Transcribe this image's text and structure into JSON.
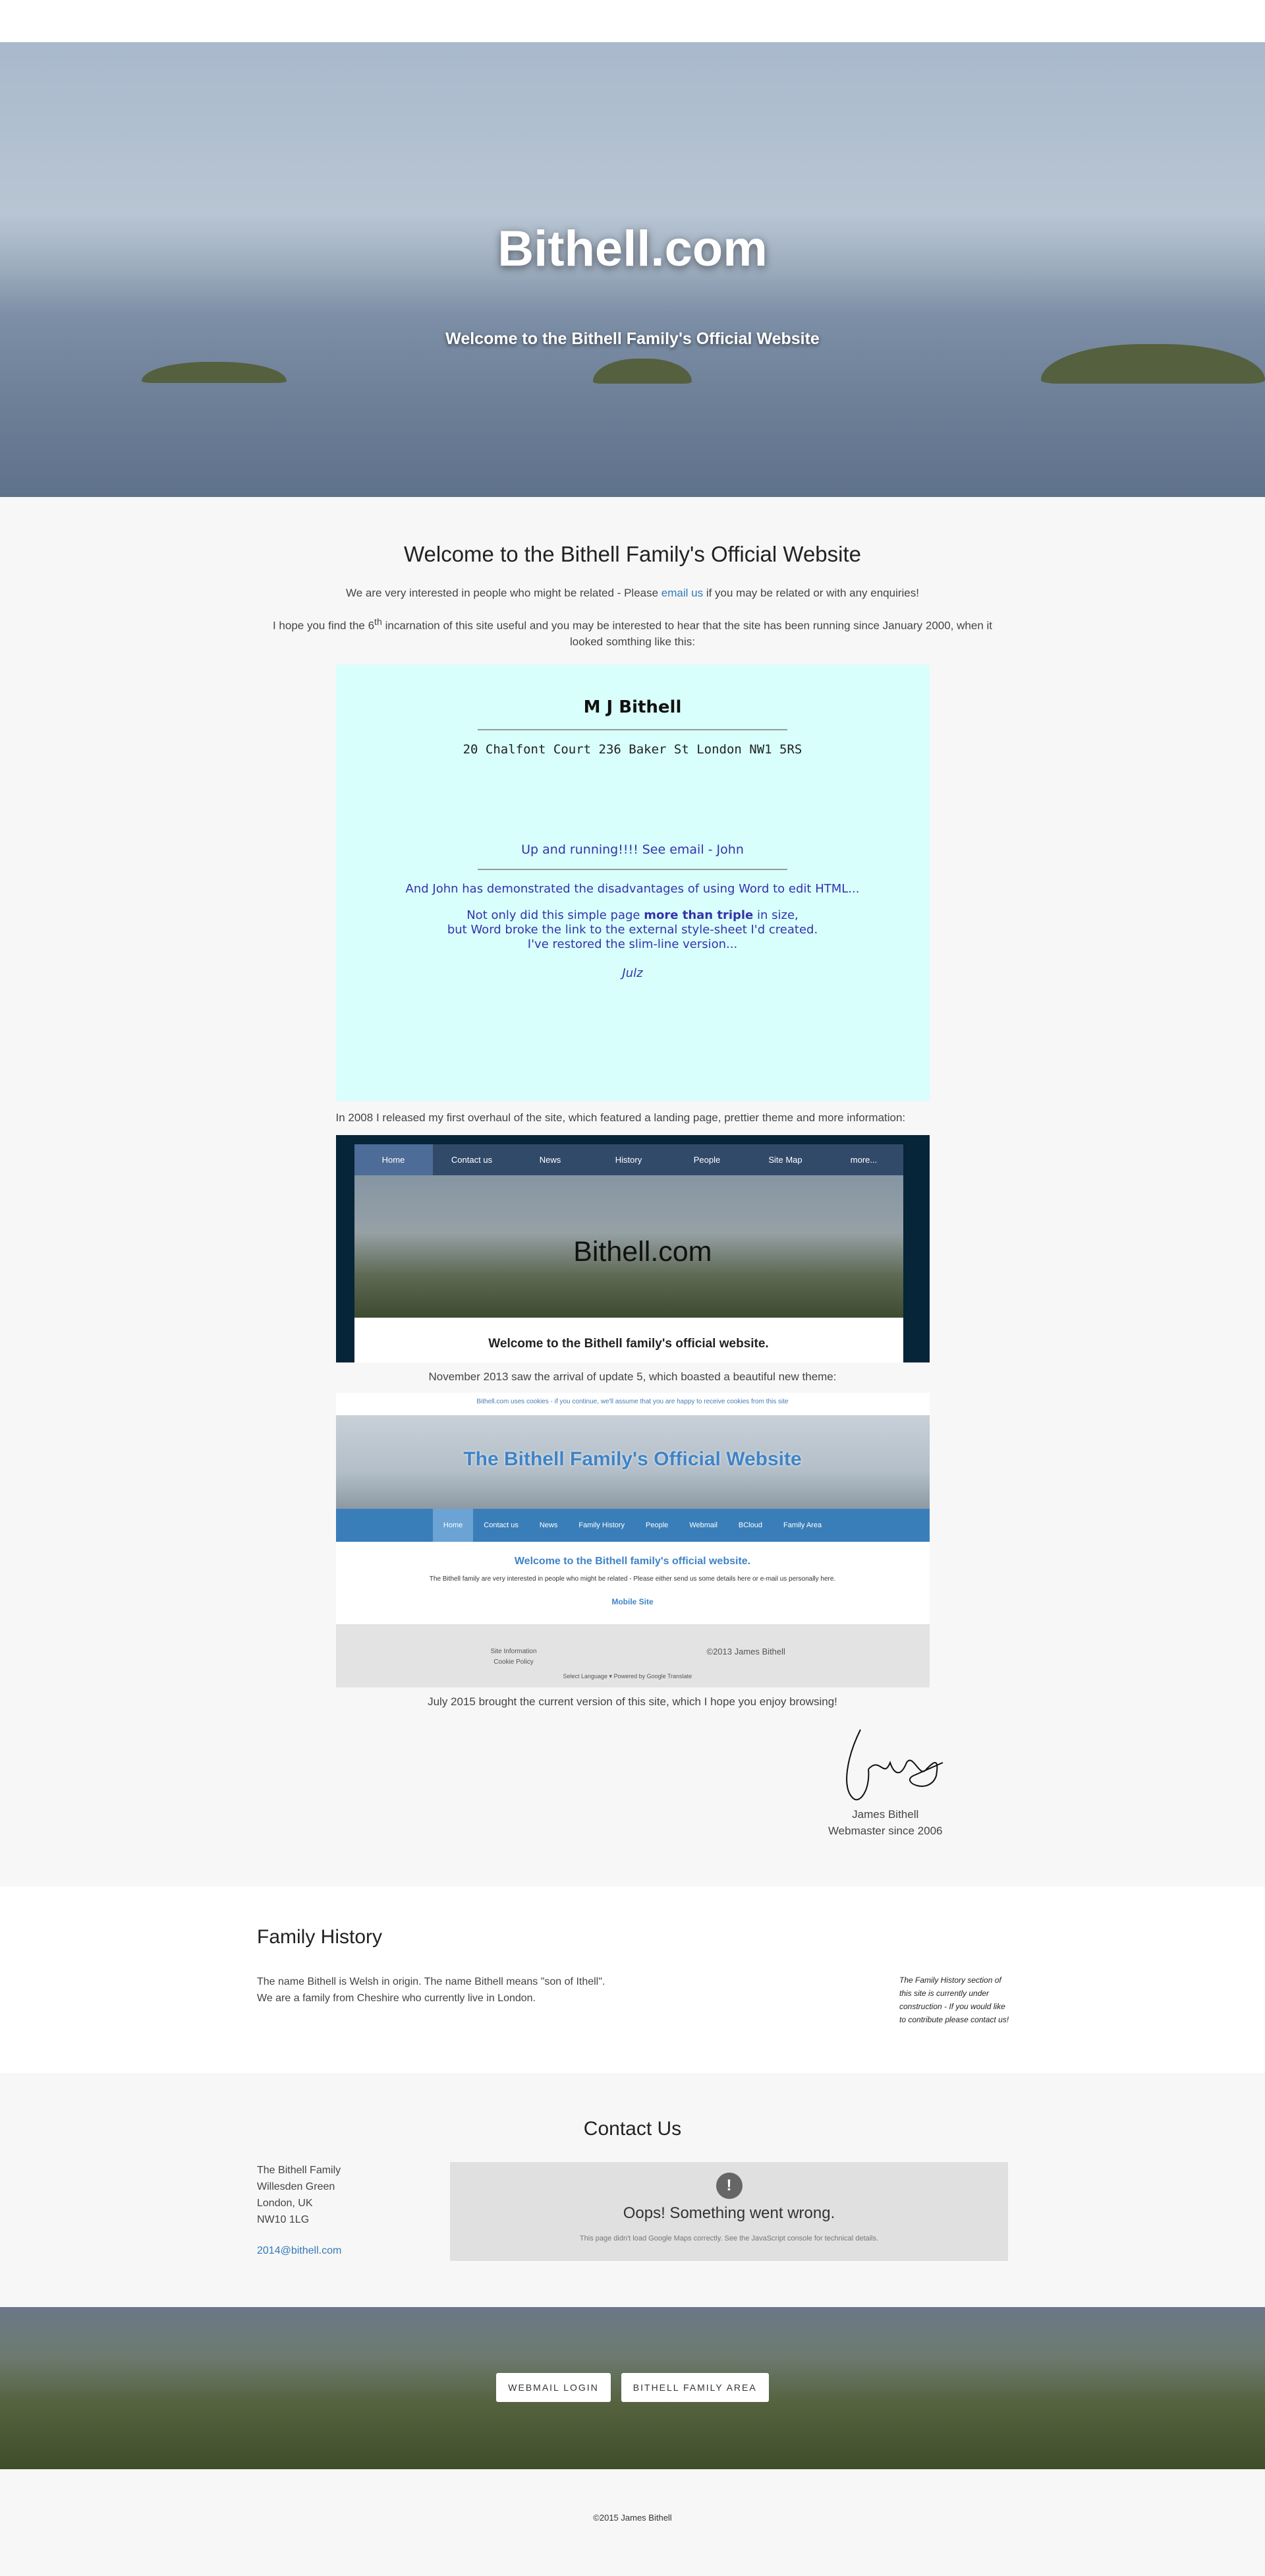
{
  "hero": {
    "title": "Bithell.com",
    "subtitle": "Welcome to the Bithell Family's Official Website"
  },
  "welcome": {
    "heading": "Welcome to the Bithell Family's Official Website",
    "p1_pre": "We are very interested in people who might be related - Please ",
    "p1_link": "email us",
    "p1_post": " if you may be related or with any enquiries!",
    "p2_pre": "I hope you find the 6",
    "p2_sup": "th",
    "p2_post": " incarnation of this site useful and you may be interested to hear that the site has been running since January 2000, when it looked somthing like this:"
  },
  "old_site": {
    "name": "M J Bithell",
    "address": "20 Chalfont Court 236 Baker St London NW1 5RS",
    "running": "Up and running!!!! See email - John",
    "john": "And John has demonstrated the disadvantages of using Word to edit HTML...",
    "l1_pre": "Not only did this simple page ",
    "l1_bold": "more than triple",
    "l1_post": " in size,",
    "l2": "but Word broke the link to the external style-sheet I'd created.",
    "l3": "I've restored the slim-line version...",
    "sig": "Julz"
  },
  "overhaul_text": "In 2008 I released my first overhaul of the site, which featured a landing page, prettier theme and more information:",
  "site2008": {
    "nav": [
      "Home",
      "Contact us",
      "News",
      "History",
      "People",
      "Site Map",
      "more..."
    ],
    "banner": "Bithell.com",
    "welcome": "Welcome to the Bithell family's official website."
  },
  "update5_text": "November 2013 saw the arrival of update 5, which boasted a beautiful new theme:",
  "site2013": {
    "cookie": "Bithell.com uses cookies - if you continue, we'll assume that you are happy to receive cookies from this site",
    "banner": "The Bithell Family's Official Website",
    "nav": [
      "Home",
      "Contact us",
      "News",
      "Family History",
      "People",
      "Webmail",
      "BCloud",
      "Family Area"
    ],
    "welcome": "Welcome to the Bithell family's official website.",
    "text": "The Bithell family are very interested in people who might be related - Please either send us some details here or e-mail us personally here.",
    "mobile": "Mobile Site",
    "footer_l1": "Site Information",
    "footer_l2": "Cookie Policy",
    "footer_copy": "©2013 James Bithell",
    "translate": "Select Language ▾  Powered by Google Translate"
  },
  "current_text": "July 2015 brought the current version of this site, which I hope you enjoy browsing!",
  "signature": {
    "name": "James Bithell",
    "role": "Webmaster since 2006"
  },
  "family_history": {
    "heading": "Family History",
    "l1": "The name Bithell is Welsh in origin. The name Bithell means \"son of Ithell\".",
    "l2": "We are a family from Cheshire who currently live in London.",
    "note": "The Family History section of this site is currently under construction - If you would like to contribute please contact us!"
  },
  "contact": {
    "heading": "Contact Us",
    "address": [
      "The Bithell Family",
      "Willesden Green",
      "London, UK",
      "NW10 1LG"
    ],
    "email": "2014@bithell.com",
    "map_error": "Oops! Something went wrong.",
    "map_detail": "This page didn't load Google Maps correctly. See the JavaScript console for technical details."
  },
  "buttons": {
    "webmail": "WEBMAIL LOGIN",
    "family_area": "BITHELL FAMILY AREA"
  },
  "copyright": "©2015 James Bithell"
}
